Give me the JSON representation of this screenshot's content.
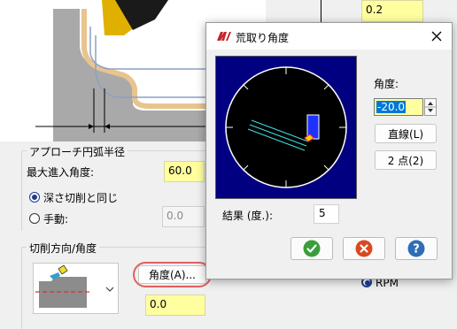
{
  "background": {
    "top_value": "0.2",
    "approach_group_title": "アプローチ円弧半径",
    "max_entry_angle_label": "最大進入角度:",
    "max_entry_angle_value": "60.0",
    "same_as_depth_label": "深さ切削と同じ",
    "manual_label": "手動:",
    "manual_value": "0.0",
    "cut_direction_group_title": "切削方向/角度",
    "angle_button_label": "角度(A)...",
    "angle_value": "0.0",
    "rpm_label": "RPM"
  },
  "dialog": {
    "title": "荒取り角度",
    "angle_label": "角度:",
    "angle_value": "-20.0",
    "line_button_label": "直線(L)",
    "two_point_button_label": "2 点(2)",
    "result_label": "結果 (度.):",
    "result_value": "5",
    "ok_icon": "check-icon",
    "cancel_icon": "x-icon",
    "help_icon": "question-icon"
  },
  "colors": {
    "field_yellow": "#ffffa0",
    "ok_green": "#3a9e3a",
    "cancel_red": "#d9481f",
    "help_blue": "#2f6db5",
    "preview_bg": "#000080",
    "highlight_red": "#e05050"
  }
}
